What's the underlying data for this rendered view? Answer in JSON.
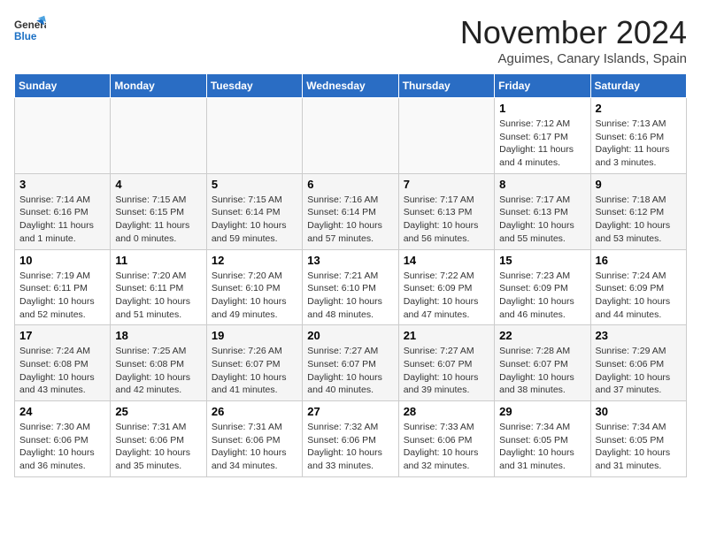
{
  "header": {
    "logo_general": "General",
    "logo_blue": "Blue",
    "month_title": "November 2024",
    "location": "Aguimes, Canary Islands, Spain"
  },
  "weekdays": [
    "Sunday",
    "Monday",
    "Tuesday",
    "Wednesday",
    "Thursday",
    "Friday",
    "Saturday"
  ],
  "weeks": [
    [
      {
        "day": "",
        "info": ""
      },
      {
        "day": "",
        "info": ""
      },
      {
        "day": "",
        "info": ""
      },
      {
        "day": "",
        "info": ""
      },
      {
        "day": "",
        "info": ""
      },
      {
        "day": "1",
        "info": "Sunrise: 7:12 AM\nSunset: 6:17 PM\nDaylight: 11 hours and 4 minutes."
      },
      {
        "day": "2",
        "info": "Sunrise: 7:13 AM\nSunset: 6:16 PM\nDaylight: 11 hours and 3 minutes."
      }
    ],
    [
      {
        "day": "3",
        "info": "Sunrise: 7:14 AM\nSunset: 6:16 PM\nDaylight: 11 hours and 1 minute."
      },
      {
        "day": "4",
        "info": "Sunrise: 7:15 AM\nSunset: 6:15 PM\nDaylight: 11 hours and 0 minutes."
      },
      {
        "day": "5",
        "info": "Sunrise: 7:15 AM\nSunset: 6:14 PM\nDaylight: 10 hours and 59 minutes."
      },
      {
        "day": "6",
        "info": "Sunrise: 7:16 AM\nSunset: 6:14 PM\nDaylight: 10 hours and 57 minutes."
      },
      {
        "day": "7",
        "info": "Sunrise: 7:17 AM\nSunset: 6:13 PM\nDaylight: 10 hours and 56 minutes."
      },
      {
        "day": "8",
        "info": "Sunrise: 7:17 AM\nSunset: 6:13 PM\nDaylight: 10 hours and 55 minutes."
      },
      {
        "day": "9",
        "info": "Sunrise: 7:18 AM\nSunset: 6:12 PM\nDaylight: 10 hours and 53 minutes."
      }
    ],
    [
      {
        "day": "10",
        "info": "Sunrise: 7:19 AM\nSunset: 6:11 PM\nDaylight: 10 hours and 52 minutes."
      },
      {
        "day": "11",
        "info": "Sunrise: 7:20 AM\nSunset: 6:11 PM\nDaylight: 10 hours and 51 minutes."
      },
      {
        "day": "12",
        "info": "Sunrise: 7:20 AM\nSunset: 6:10 PM\nDaylight: 10 hours and 49 minutes."
      },
      {
        "day": "13",
        "info": "Sunrise: 7:21 AM\nSunset: 6:10 PM\nDaylight: 10 hours and 48 minutes."
      },
      {
        "day": "14",
        "info": "Sunrise: 7:22 AM\nSunset: 6:09 PM\nDaylight: 10 hours and 47 minutes."
      },
      {
        "day": "15",
        "info": "Sunrise: 7:23 AM\nSunset: 6:09 PM\nDaylight: 10 hours and 46 minutes."
      },
      {
        "day": "16",
        "info": "Sunrise: 7:24 AM\nSunset: 6:09 PM\nDaylight: 10 hours and 44 minutes."
      }
    ],
    [
      {
        "day": "17",
        "info": "Sunrise: 7:24 AM\nSunset: 6:08 PM\nDaylight: 10 hours and 43 minutes."
      },
      {
        "day": "18",
        "info": "Sunrise: 7:25 AM\nSunset: 6:08 PM\nDaylight: 10 hours and 42 minutes."
      },
      {
        "day": "19",
        "info": "Sunrise: 7:26 AM\nSunset: 6:07 PM\nDaylight: 10 hours and 41 minutes."
      },
      {
        "day": "20",
        "info": "Sunrise: 7:27 AM\nSunset: 6:07 PM\nDaylight: 10 hours and 40 minutes."
      },
      {
        "day": "21",
        "info": "Sunrise: 7:27 AM\nSunset: 6:07 PM\nDaylight: 10 hours and 39 minutes."
      },
      {
        "day": "22",
        "info": "Sunrise: 7:28 AM\nSunset: 6:07 PM\nDaylight: 10 hours and 38 minutes."
      },
      {
        "day": "23",
        "info": "Sunrise: 7:29 AM\nSunset: 6:06 PM\nDaylight: 10 hours and 37 minutes."
      }
    ],
    [
      {
        "day": "24",
        "info": "Sunrise: 7:30 AM\nSunset: 6:06 PM\nDaylight: 10 hours and 36 minutes."
      },
      {
        "day": "25",
        "info": "Sunrise: 7:31 AM\nSunset: 6:06 PM\nDaylight: 10 hours and 35 minutes."
      },
      {
        "day": "26",
        "info": "Sunrise: 7:31 AM\nSunset: 6:06 PM\nDaylight: 10 hours and 34 minutes."
      },
      {
        "day": "27",
        "info": "Sunrise: 7:32 AM\nSunset: 6:06 PM\nDaylight: 10 hours and 33 minutes."
      },
      {
        "day": "28",
        "info": "Sunrise: 7:33 AM\nSunset: 6:06 PM\nDaylight: 10 hours and 32 minutes."
      },
      {
        "day": "29",
        "info": "Sunrise: 7:34 AM\nSunset: 6:05 PM\nDaylight: 10 hours and 31 minutes."
      },
      {
        "day": "30",
        "info": "Sunrise: 7:34 AM\nSunset: 6:05 PM\nDaylight: 10 hours and 31 minutes."
      }
    ]
  ]
}
